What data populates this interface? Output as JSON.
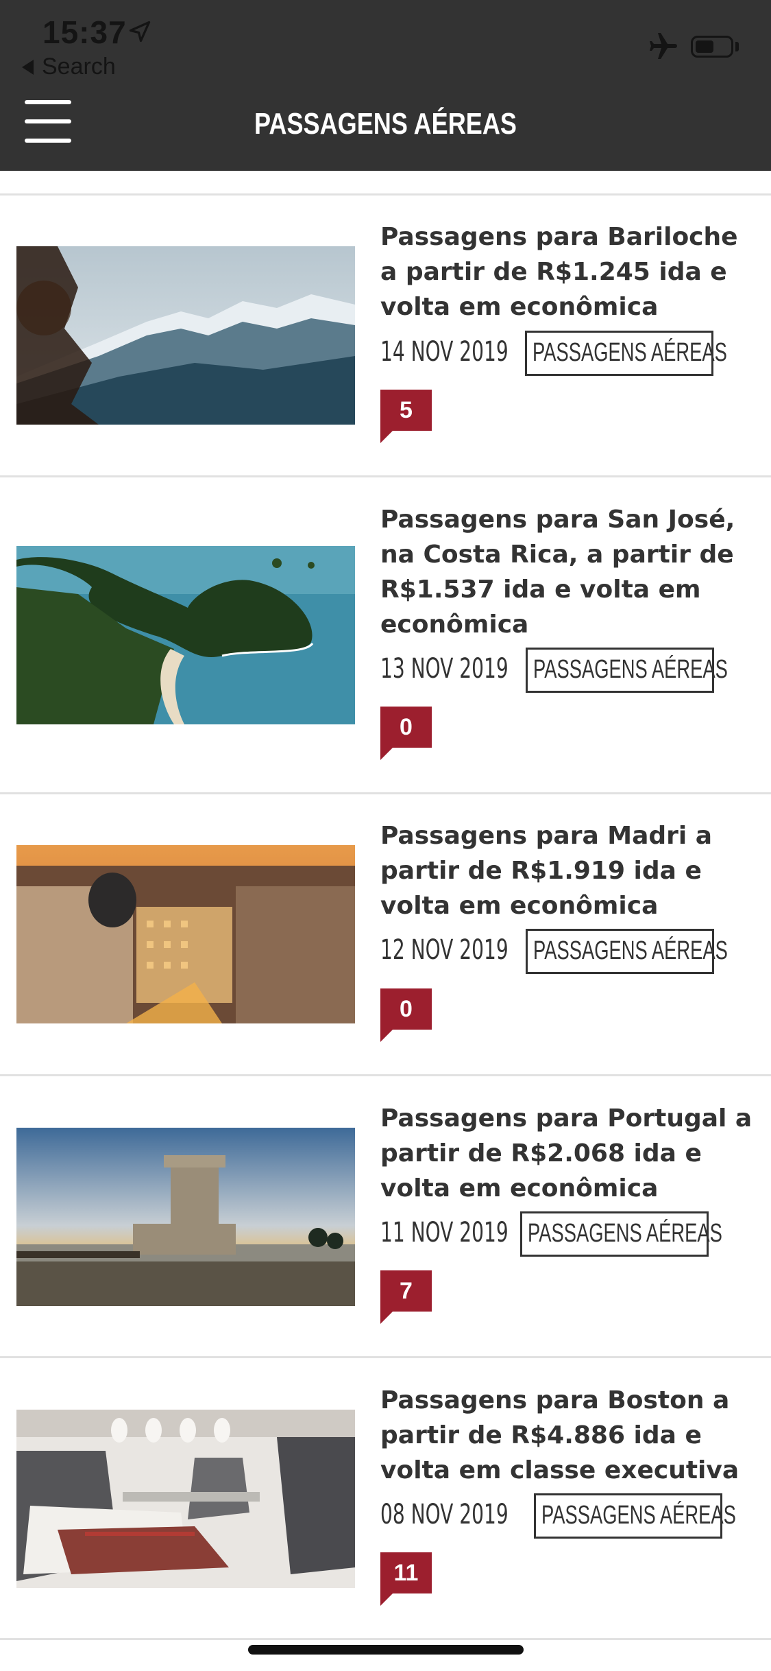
{
  "status_bar": {
    "time": "15:37",
    "back_label": "Search"
  },
  "header": {
    "title": "PASSAGENS AÉREAS"
  },
  "articles": [
    {
      "title": "Passagens para Bariloche a partir de R$1.245 ida e volta em econômica",
      "date": "14 NOV 2019",
      "category": "PASSAGENS AÉREAS",
      "comments": "5",
      "image": "snowy-mountains"
    },
    {
      "title": "Passagens para San José, na Costa Rica, a partir de R$1.537 ida e volta em econômica",
      "date": "13 NOV 2019",
      "category": "PASSAGENS AÉREAS",
      "comments": "0",
      "image": "tropical-coast"
    },
    {
      "title": "Passagens para Madri a partir de R$1.919 ida e volta em econômica",
      "date": "12 NOV 2019",
      "category": "PASSAGENS AÉREAS",
      "comments": "0",
      "image": "city-sunset"
    },
    {
      "title": "Passagens para Portugal a partir de R$2.068 ida e volta em econômica",
      "date": "11 NOV 2019",
      "category": "PASSAGENS AÉREAS",
      "comments": "7",
      "image": "belem-tower"
    },
    {
      "title": "Passagens para Boston a partir de R$4.886 ida e volta em classe executiva",
      "date": "08 NOV 2019",
      "category": "PASSAGENS AÉREAS",
      "comments": "11",
      "image": "business-class-cabin"
    }
  ],
  "colors": {
    "header_bg": "#333333",
    "badge": "#9c1f2e",
    "text": "#333333",
    "divider": "#e1e1e1"
  }
}
